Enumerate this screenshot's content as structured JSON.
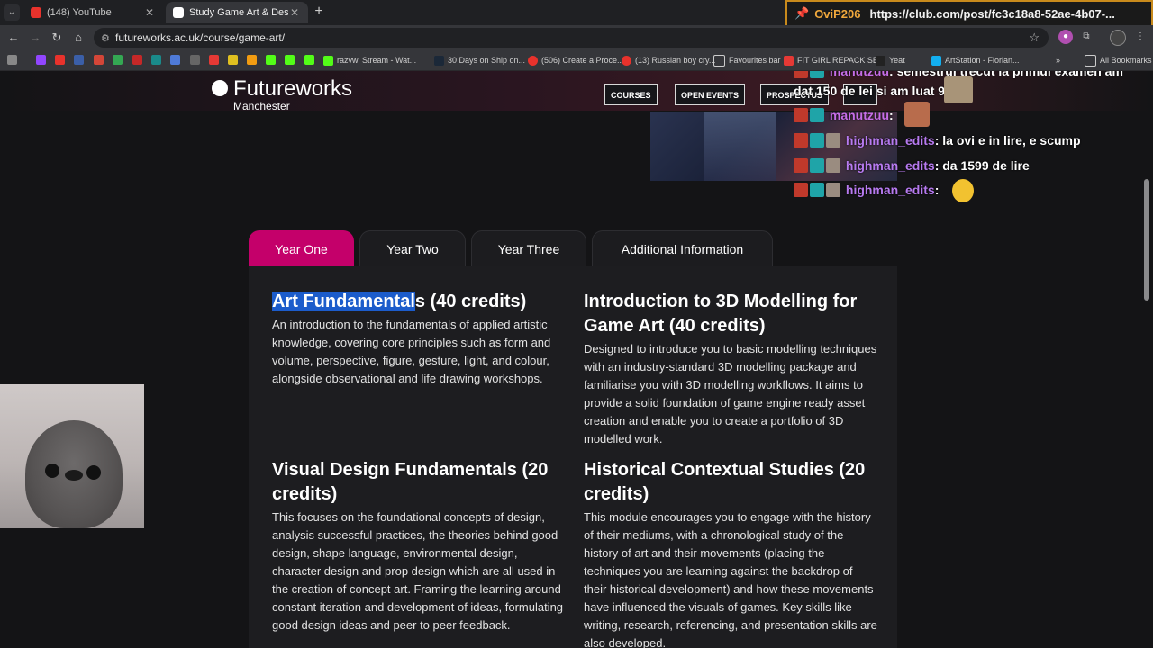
{
  "browser": {
    "tabs": [
      {
        "title": "(148) YouTube",
        "active": false
      },
      {
        "title": "Study Game Art & Design BA (H",
        "active": true
      }
    ],
    "url": "futureworks.ac.uk/course/game-art/",
    "bookmarks": [
      {
        "label": "razvwi Stream - Wat..."
      },
      {
        "label": "30 Days on Ship on..."
      },
      {
        "label": "(506) Create a Proce..."
      },
      {
        "label": "(13) Russian boy cry..."
      },
      {
        "label": "Favourites bar"
      },
      {
        "label": "FIT GIRL REPACK SE..."
      },
      {
        "label": "Yeat"
      },
      {
        "label": "ArtStation - Florian..."
      },
      {
        "label": "All Bookmarks"
      }
    ]
  },
  "overlay": {
    "user": "OviP206",
    "link": "https://club.com/post/fc3c18a8-52ae-4b07-..."
  },
  "chat": [
    {
      "name": "manutzuu",
      "message": "semestrul trecut la primul examen am dat 150 de lei si am luat 9",
      "line1": "semestrul trecut la primul examen am",
      "line2": "dat 150 de lei si am luat 9"
    },
    {
      "name": "manutzuu",
      "message": ""
    },
    {
      "name": "highman_edits",
      "message": "la ovi e in lire, e scump"
    },
    {
      "name": "highman_edits",
      "message": "da 1599 de lire"
    },
    {
      "name": "highman_edits",
      "message": ""
    }
  ],
  "site": {
    "logo": "Futureworks",
    "logo_sub": "Manchester",
    "nav": [
      "COURSES",
      "OPEN EVENTS",
      "PROSPECTUS"
    ]
  },
  "course_tabs": [
    "Year One",
    "Year Two",
    "Year Three",
    "Additional Information"
  ],
  "modules": [
    {
      "title_highlight": "Art Fundamental",
      "title_rest": "s (40 credits)",
      "description": "An introduction to the fundamentals of applied artistic knowledge, covering core principles such as form and volume, perspective, figure, gesture, light, and colour, alongside observational and life drawing workshops."
    },
    {
      "title": "Introduction to 3D Modelling for Game Art (40 credits)",
      "description": "Designed to introduce you to basic modelling techniques with an industry-standard 3D modelling package and familiarise you with 3D modelling workflows. It aims to provide a solid foundation of game engine ready asset creation and enable you to create a portfolio of 3D modelled work."
    },
    {
      "title": "Visual Design Fundamentals (20 credits)",
      "description": "This focuses on the foundational concepts of design, analysis successful practices, the theories behind good design, shape language, environmental design, character design and prop design which are all used in the creation of concept art. Framing the learning around constant iteration and development of ideas, formulating good design ideas and peer to peer feedback."
    },
    {
      "title": "Historical Contextual Studies (20 credits)",
      "description": "This module encourages you to engage with the history of their mediums, with a chronological study of the history of art and their movements (placing the techniques you are learning against the backdrop of their historical development) and how these movements have influenced the visuals of games. Key skills like writing, research, referencing, and presentation skills are also developed."
    }
  ],
  "colors": {
    "accent": "#c4006a",
    "selection": "#1c5ccb",
    "overlay_border": "#c88a1c"
  }
}
